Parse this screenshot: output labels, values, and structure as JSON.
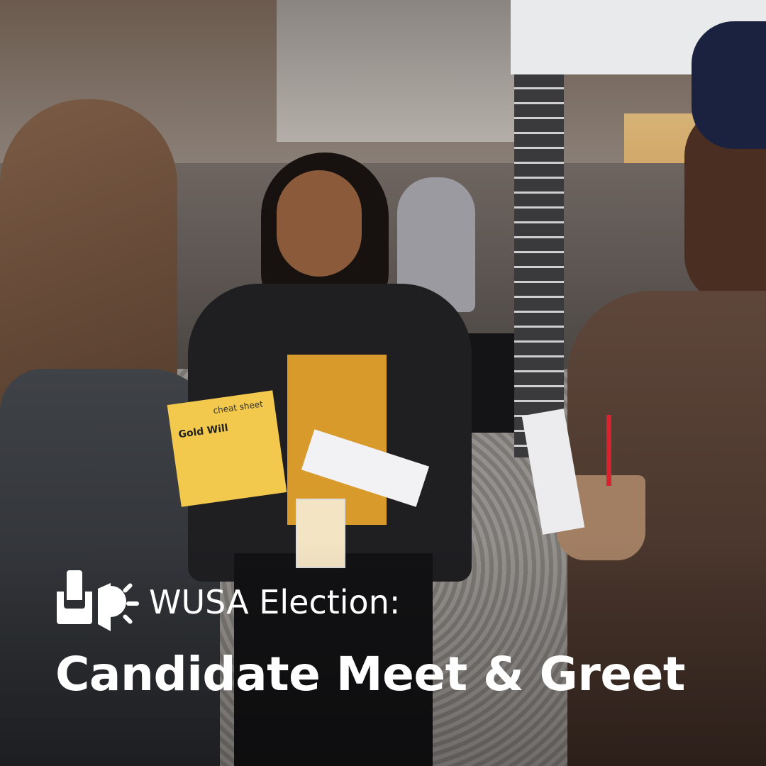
{
  "overlay": {
    "logo_icon": "ballot-box-megaphone-icon",
    "subtitle": "WUSA Election:",
    "title": "Candidate Meet & Greet"
  },
  "photo": {
    "flyer_heading": "cheat sheet",
    "flyer_text": "Gold Will",
    "colors": {
      "mustard_top": "#d79a2b",
      "flyer_yellow": "#f2c94c",
      "blazer": "#1f1f22",
      "carpet": "#8d8b88"
    }
  }
}
